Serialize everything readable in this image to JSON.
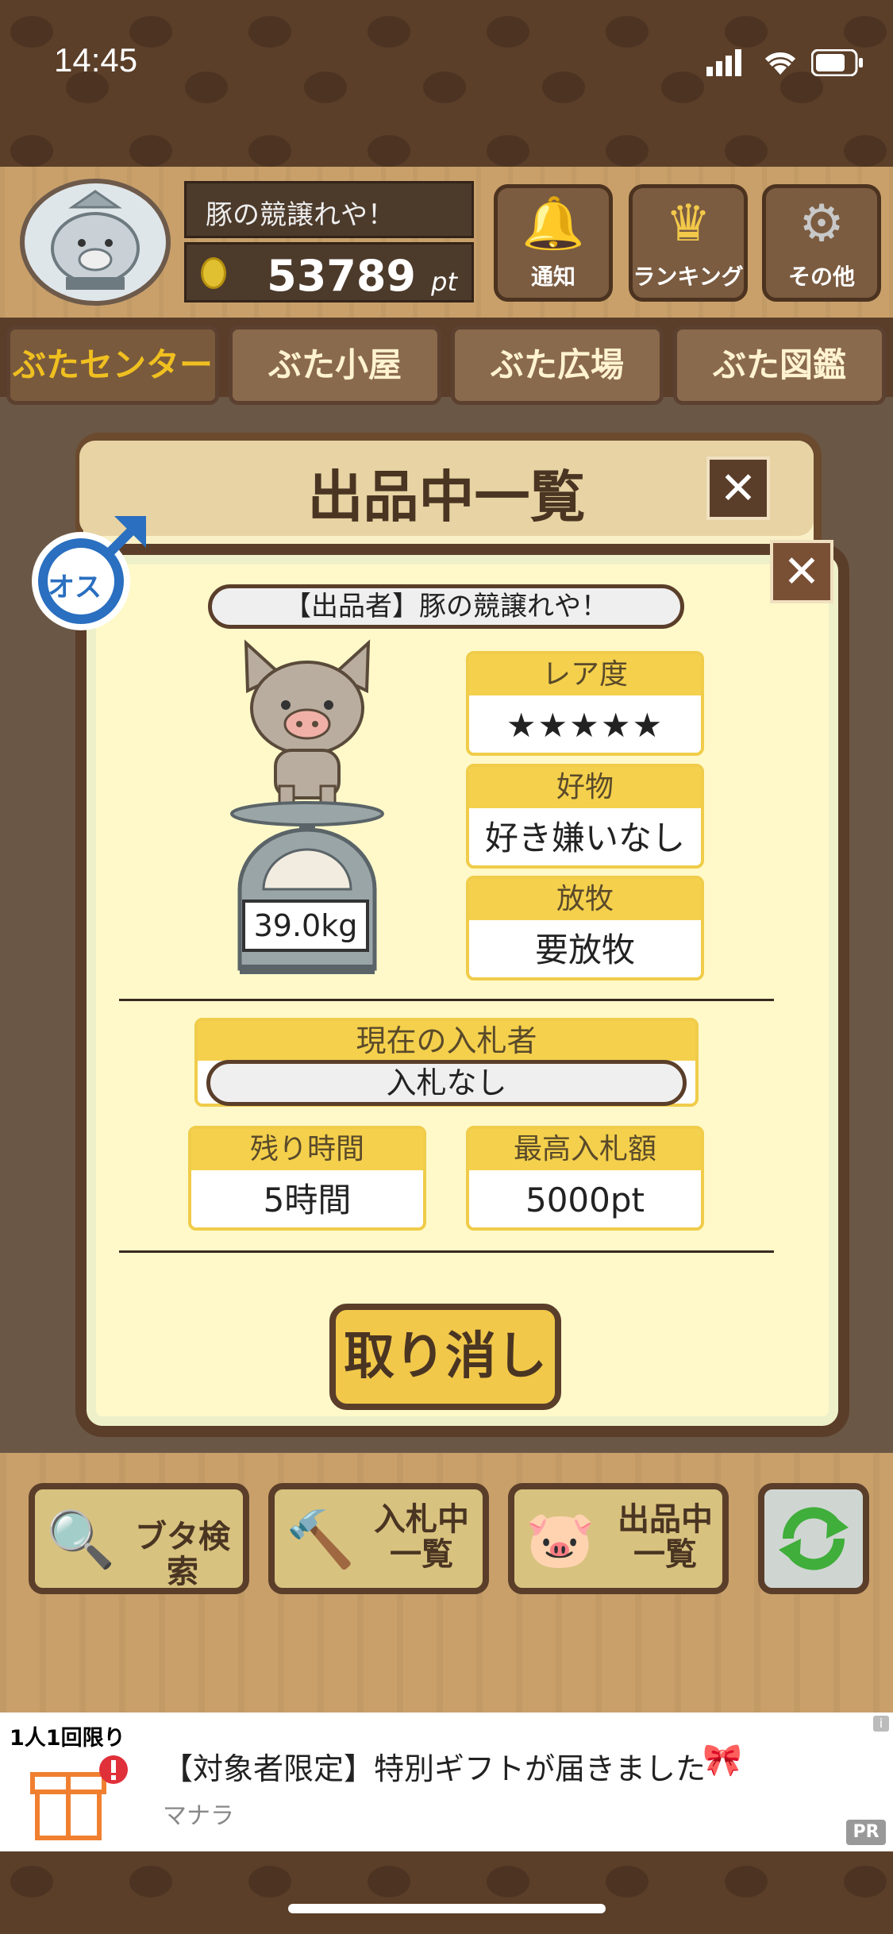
{
  "status_bar": {
    "time": "14:45"
  },
  "header": {
    "player_name": "豚の競譲れや！",
    "points_value": "53789",
    "points_unit": "pt",
    "buttons": [
      {
        "label": "通知",
        "icon": "bell-icon"
      },
      {
        "label": "ランキング",
        "icon": "crown-icon"
      },
      {
        "label": "その他",
        "icon": "gear-icon"
      }
    ]
  },
  "tabs": [
    "ぶたセンター",
    "ぶた小屋",
    "ぶた広場",
    "ぶた図鑑"
  ],
  "modal": {
    "title": "出品中一覧",
    "gender_label": "オス",
    "seller": "【出品者】豚の競譲れや！",
    "weight": "39.0kg",
    "rarity": {
      "label": "レア度",
      "stars": 5,
      "stars_text": "★★★★★"
    },
    "favorite": {
      "label": "好物",
      "value": "好き嫌いなし"
    },
    "grazing": {
      "label": "放牧",
      "value": "要放牧"
    },
    "current_bidder": {
      "label": "現在の入札者",
      "value": "入札なし"
    },
    "remaining": {
      "label": "残り時間",
      "value": "5時間"
    },
    "highest_bid": {
      "label": "最高入札額",
      "value": "5000pt"
    },
    "cancel_label": "取り消し"
  },
  "bottom_buttons": [
    {
      "label": "ブタ検索",
      "icon": "magnifier-icon"
    },
    {
      "label": "入札中一覧",
      "icon": "gavel-icon"
    },
    {
      "label": "出品中一覧",
      "icon": "pig-icon"
    },
    {
      "label": "",
      "icon": "refresh-icon"
    }
  ],
  "ad": {
    "badge": "1人1回限り",
    "text": "【対象者限定】特別ギフトが届きました",
    "source": "マナラ",
    "pr": "PR"
  },
  "colors": {
    "accent_yellow": "#f4d04c",
    "wood_dark": "#5a3e2a",
    "star": "#e07a7a"
  }
}
